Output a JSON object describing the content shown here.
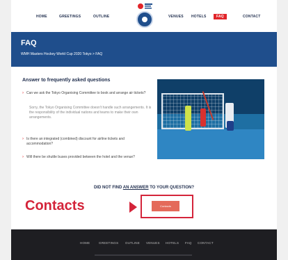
{
  "nav": {
    "items": [
      {
        "label": "HOME"
      },
      {
        "label": "GREETINGS"
      },
      {
        "label": "OUTLINE"
      },
      {
        "label": "VENUES"
      },
      {
        "label": "HOTELS"
      },
      {
        "label": "FAQ",
        "active": true
      },
      {
        "label": "CONTACT"
      }
    ]
  },
  "banner": {
    "title": "FAQ",
    "breadcrumb": "WMH Masters Hockey World Cup 2020 Tokyo > FAQ"
  },
  "faq": {
    "heading": "Answer to frequently asked questions",
    "items": [
      {
        "question": "Can we ask the Tokyo Organising Committee to book and arrange air tickets?",
        "answer": "Sorry, the Tokyo Organising Committee doesn't handle such arrangements. It is the responsibility of the individual nations and teams to make their own arrangements."
      },
      {
        "question": "Is there an integrated (combined) discount for airline tickets and accommodation?"
      },
      {
        "question": "Will there be shuttle buses provided between the hotel and the venue?"
      }
    ]
  },
  "not_found": {
    "prefix": "DID NOT FIND ",
    "underline": "AN ANSWER",
    "suffix": " TO YOUR QUESTION?"
  },
  "contacts": {
    "label": "Contacts",
    "button_label": "Contacts"
  },
  "footer": {
    "items": [
      "HOME",
      "GREETINGS",
      "OUTLINE",
      "VENUES",
      "HOTELS",
      "FAQ",
      "CONTACT"
    ]
  },
  "colors": {
    "primary": "#1f4e8c",
    "accent": "#e1252a",
    "footer": "#1e1e22"
  }
}
